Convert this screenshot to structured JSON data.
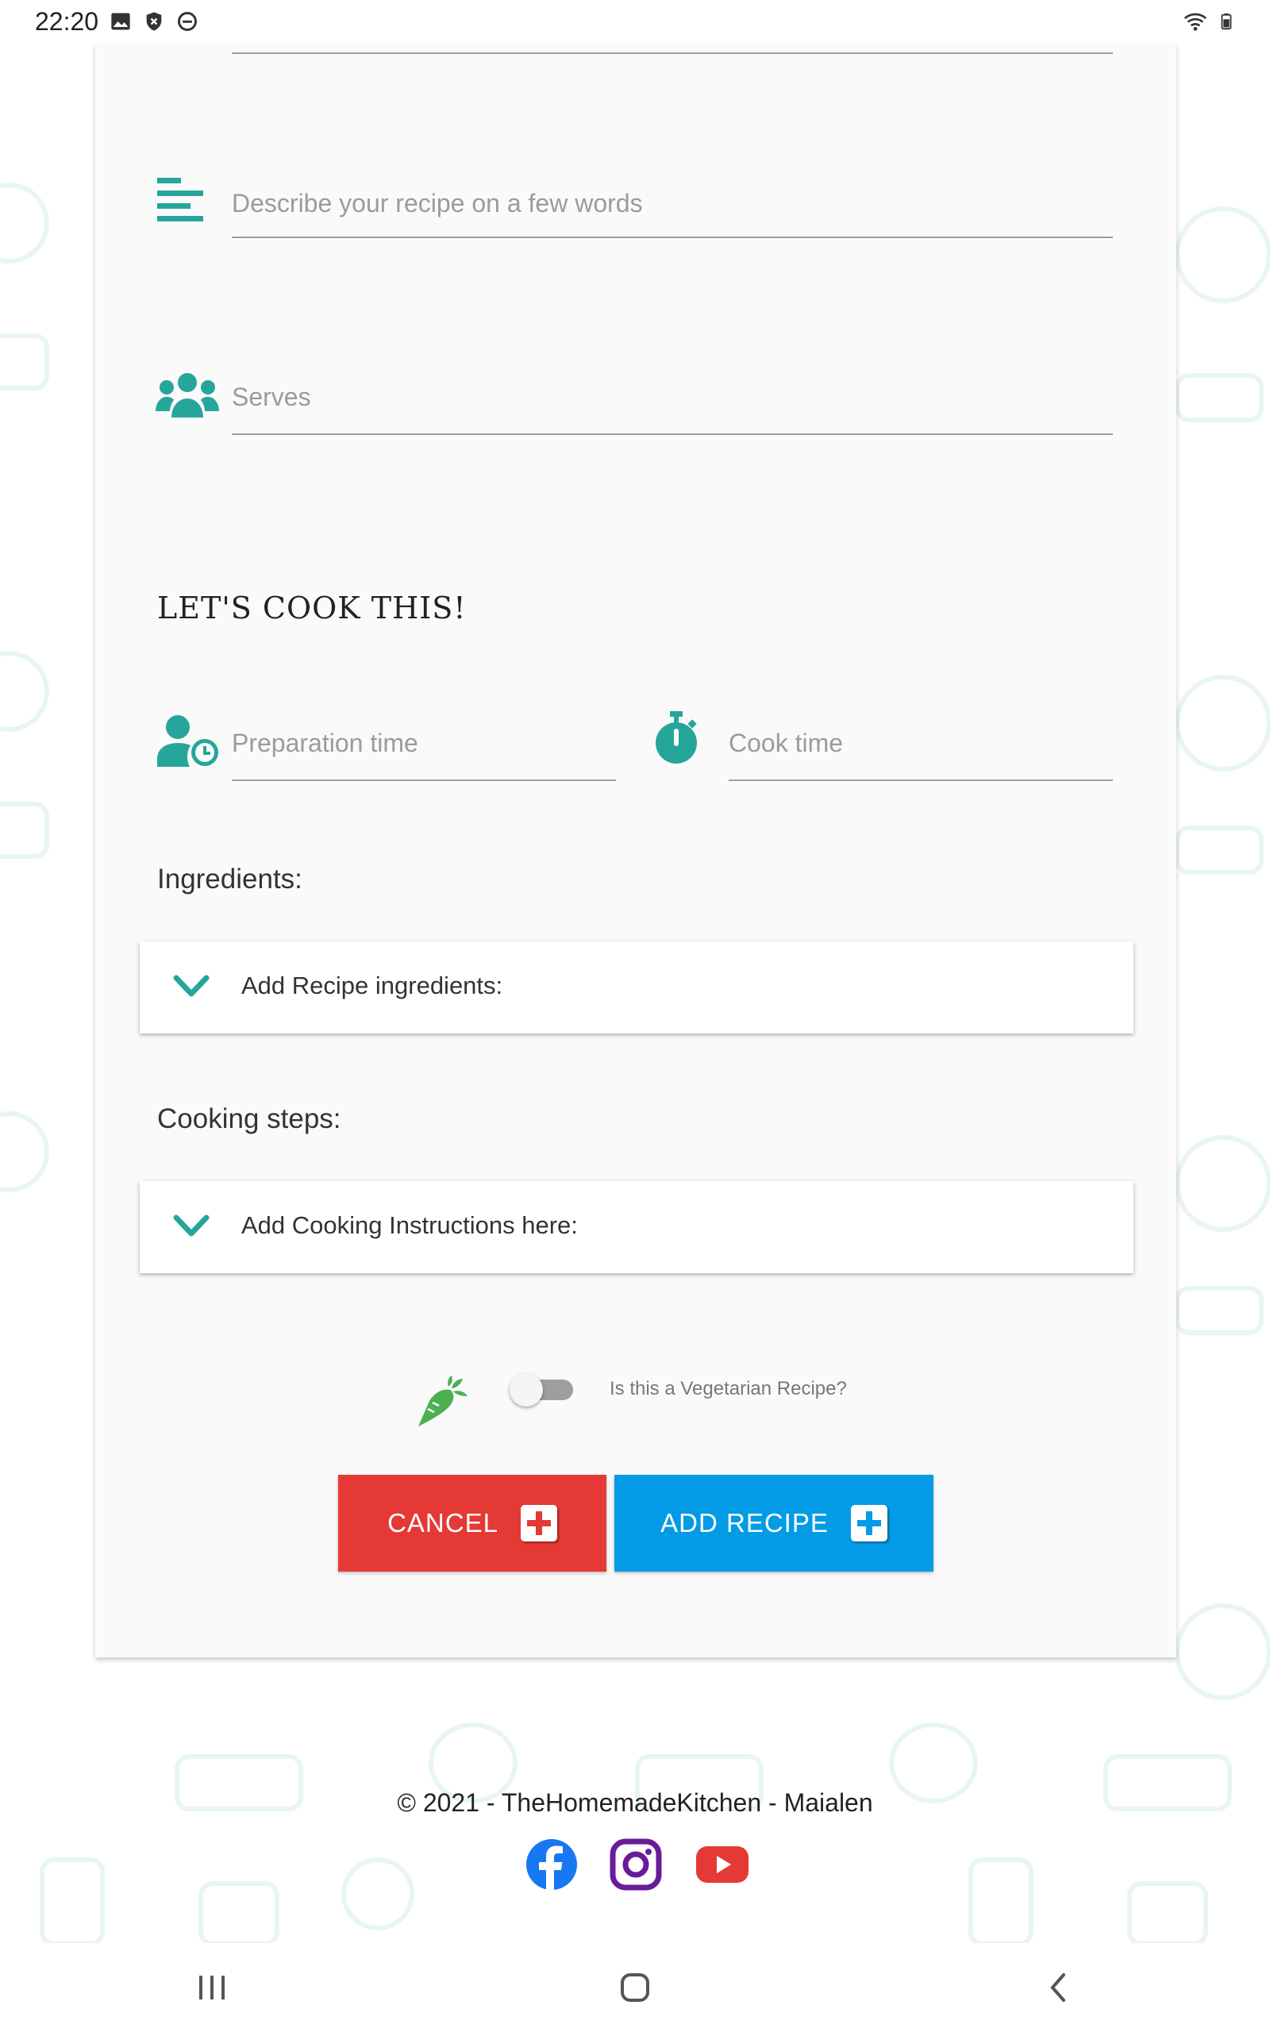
{
  "status_bar": {
    "time": "22:20",
    "left_icons": [
      "image-icon",
      "shield-icon",
      "do-not-disturb-icon"
    ],
    "right_icons": [
      "wifi-icon",
      "battery-icon"
    ]
  },
  "form": {
    "description_placeholder": "Describe your recipe on a few words",
    "serves_placeholder": "Serves",
    "section_title": "LET'S COOK THIS!",
    "prep_time_placeholder": "Preparation time",
    "cook_time_placeholder": "Cook time",
    "ingredients_label": "Ingredients:",
    "ingredients_expander": "Add Recipe ingredients:",
    "steps_label": "Cooking steps:",
    "steps_expander": "Add Cooking Instructions here:",
    "vegetarian_label": "Is this a Vegetarian Recipe?",
    "vegetarian_checked": false
  },
  "buttons": {
    "cancel": "CANCEL",
    "add_recipe": "ADD RECIPE"
  },
  "footer": {
    "copyright": "© 2021 - TheHomemadeKitchen - Maialen",
    "socials": [
      "facebook-icon",
      "instagram-icon",
      "youtube-icon"
    ]
  },
  "colors": {
    "accent": "#26a69a",
    "cancel": "#e53935",
    "add": "#039be5",
    "facebook": "#1877f2",
    "instagram": "#6a1b9a",
    "youtube": "#e53935",
    "vegetarian": "#4caf50"
  }
}
